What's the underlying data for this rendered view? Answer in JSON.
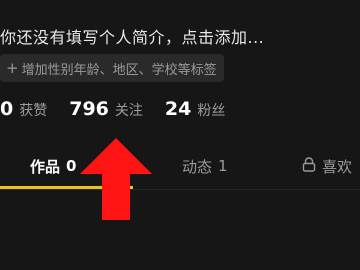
{
  "profile": {
    "bio_placeholder": "你还没有填写个人简介，点击添加...",
    "tag_button": "增加性别年龄、地区、学校等标签"
  },
  "stats": {
    "likes": {
      "value": "0",
      "label": "获赞"
    },
    "following": {
      "value": "796",
      "label": "关注"
    },
    "followers": {
      "value": "24",
      "label": "粉丝"
    }
  },
  "tabs": {
    "works": {
      "label": "作品",
      "count": "0"
    },
    "moments": {
      "label": "动态",
      "count": "1"
    },
    "likes": {
      "label": "喜欢"
    }
  },
  "colors": {
    "background": "#161616",
    "tab_underline": "#e6c41c",
    "annotation_arrow": "#ff1414"
  }
}
